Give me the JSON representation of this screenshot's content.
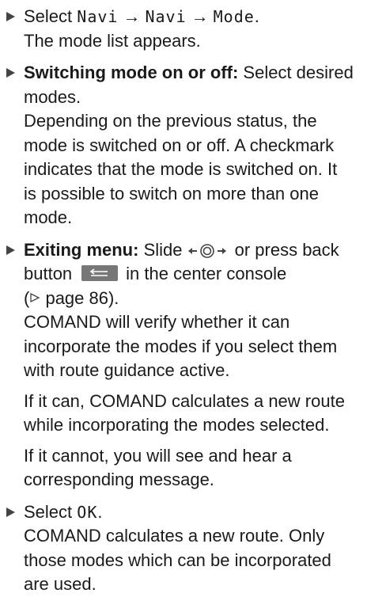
{
  "step1": {
    "select": "Select",
    "menu1": "Navi",
    "arrow1": "→",
    "menu2": "Navi",
    "arrow2": "→",
    "menu3": "Mode",
    "period": ".",
    "result": "The mode list appears."
  },
  "step2": {
    "heading": "Switching mode on or off:",
    "text_line1_rest": " Select desired",
    "text_line2": "modes.",
    "para_lines": [
      "Depending on the previous status, the",
      "mode is switched on or off. A checkmark",
      "indicates that the mode is switched on. It",
      "is possible to switch on more than one",
      "mode."
    ]
  },
  "step3": {
    "heading": "Exiting menu:",
    "slide": " Slide",
    "or_press": " or press back",
    "button_word": "button",
    "in_console": "in the center console",
    "page_ref": "page 86).",
    "para1_lines": [
      "COMAND will verify whether it can",
      "incorporate the modes if you select them",
      "with route guidance active."
    ],
    "para2_lines": [
      "If it can, COMAND calculates a new route",
      "while incorporating the modes selected."
    ],
    "para3_lines": [
      "If it cannot, you will see and hear a",
      "corresponding message."
    ]
  },
  "step4": {
    "select": "Select",
    "ok": "OK",
    "period": ".",
    "result_lines": [
      "COMAND calculates a new route. Only",
      "those modes which can be incorporated",
      "are used."
    ]
  },
  "colors": {
    "text": "#1a1a1a",
    "bullet": "#444444",
    "back_button": "#777777"
  }
}
